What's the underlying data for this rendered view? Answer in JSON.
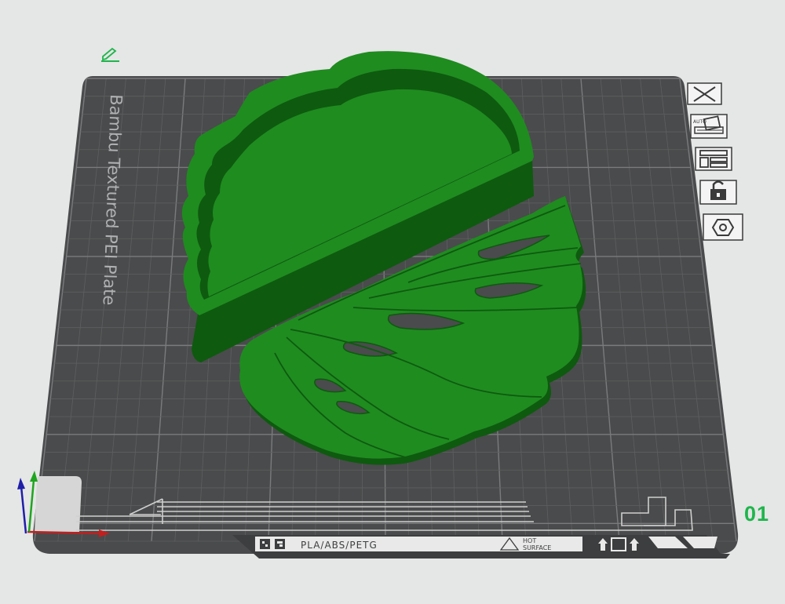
{
  "plate": {
    "name": "Bambu Textured PEI Plate",
    "number": "01",
    "filament_label": "PLA/ABS/PETG",
    "warning_line1": "HOT",
    "warning_line2": "SURFACE"
  },
  "toolbar": {
    "buttons": [
      {
        "name": "close-plate-button",
        "icon": "close-icon"
      },
      {
        "name": "auto-orient-button",
        "icon": "auto-orient-icon"
      },
      {
        "name": "arrange-button",
        "icon": "arrange-icon"
      },
      {
        "name": "lock-plate-button",
        "icon": "lock-icon"
      },
      {
        "name": "plate-settings-button",
        "icon": "hexagon-settings-icon"
      }
    ],
    "auto_label": "AUTO"
  },
  "colors": {
    "background": "#e5e6e6",
    "plate": "#4a4b4c",
    "grid": "#6b6c6d",
    "model": "#1b8a1b",
    "model_dark": "#0f5d10",
    "accent": "#1fb54c"
  },
  "axes": {
    "x": "red",
    "y": "green",
    "z": "blue"
  }
}
